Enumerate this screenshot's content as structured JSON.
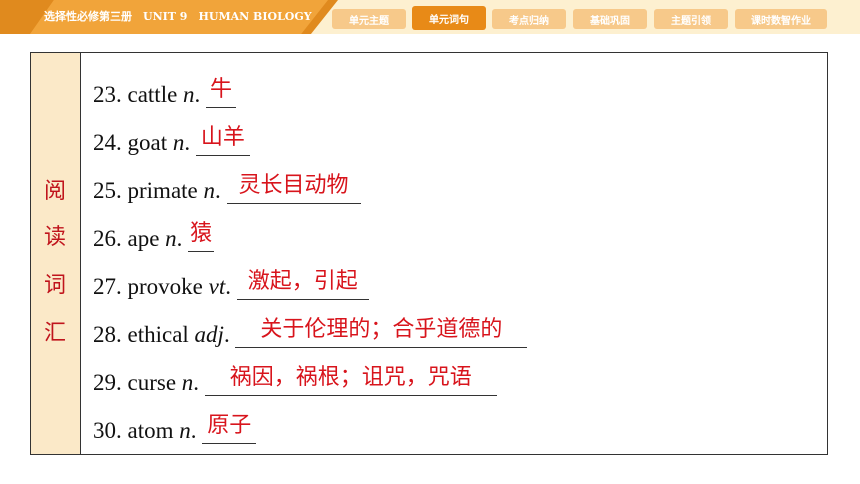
{
  "header": {
    "title": "选择性必修第三册　UNIT 9　HUMAN BIOLOGY",
    "tabs": [
      "单元主题",
      "单元词句",
      "考点归纳",
      "基础巩固",
      "主题引领",
      "课时数智作业"
    ],
    "active_tab": "单元词句"
  },
  "sidebar": {
    "chars": [
      "阅",
      "读",
      "词",
      "汇"
    ]
  },
  "vocab": [
    {
      "num": "23.",
      "word": "cattle ",
      "pos": "n",
      "answer": "牛"
    },
    {
      "num": "24.",
      "word": "goat ",
      "pos": "n",
      "answer": "山羊"
    },
    {
      "num": "25.",
      "word": "primate ",
      "pos": "n",
      "answer": "灵长目动物"
    },
    {
      "num": "26.",
      "word": "ape ",
      "pos": "n",
      "answer": "猿"
    },
    {
      "num": "27.",
      "word": "provoke ",
      "pos": "vt",
      "answer": "激起，引起"
    },
    {
      "num": "28.",
      "word": "ethical ",
      "pos": "adj",
      "answer": "关于伦理的；合乎道德的"
    },
    {
      "num": "29.",
      "word": "curse ",
      "pos": "n",
      "answer": "祸因，祸根；诅咒，咒语"
    },
    {
      "num": "30.",
      "word": "atom ",
      "pos": "n",
      "answer": "原子"
    }
  ],
  "colors": {
    "accent": "#e88a17",
    "answer": "#d8141c",
    "sidebar_bg": "#fbe9c8"
  }
}
